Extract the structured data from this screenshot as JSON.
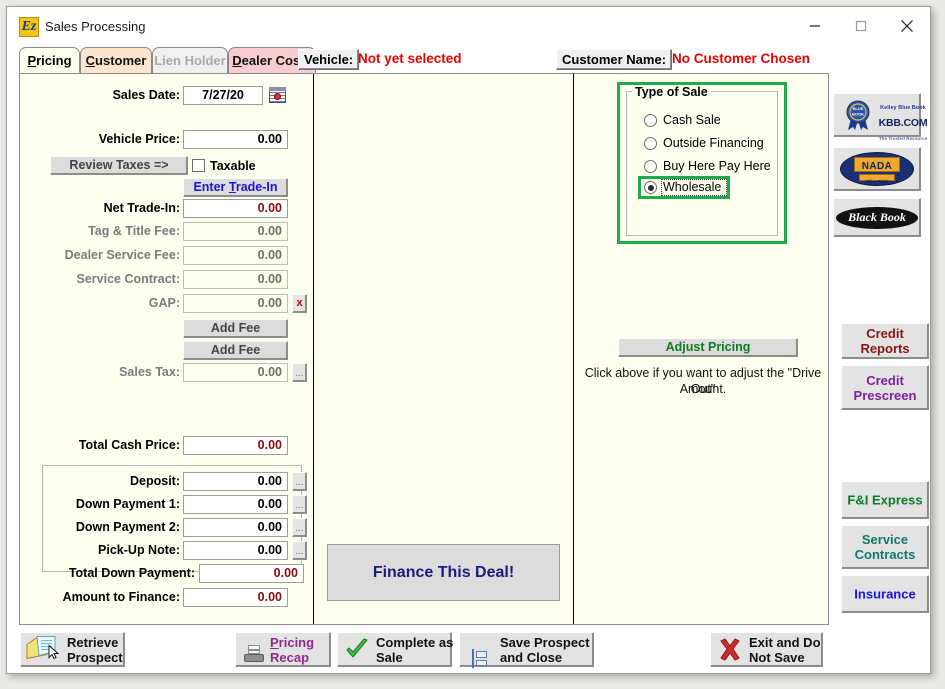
{
  "window": {
    "title": "Sales Processing",
    "app_icon": "ez-logo-icon",
    "minimize_label": "Minimize",
    "maximize_label": "Maximize",
    "close_label": "Close"
  },
  "tabs": [
    {
      "label": "Pricing",
      "accel": "P",
      "state": "active"
    },
    {
      "label": "Customer",
      "accel": "C",
      "state": "normal"
    },
    {
      "label": "Lien Holder",
      "accel": "",
      "state": "disabled"
    },
    {
      "label": "Dealer Costs",
      "accel": "D",
      "state": "normal"
    }
  ],
  "header": {
    "vehicle_button": "Vehicle:",
    "vehicle_value": "Not yet selected",
    "customer_button": "Customer Name:",
    "customer_value": "No Customer Chosen"
  },
  "form": {
    "sales_date_label": "Sales Date:",
    "sales_date_value": "7/27/20",
    "calendar_icon": "calendar-icon",
    "vehicle_price_label": "Vehicle Price:",
    "vehicle_price_value": "0.00",
    "review_taxes_button": "Review Taxes =>",
    "taxable_label": "Taxable",
    "taxable_checked": false,
    "enter_trade_in_button": "Enter Trade-In",
    "enter_trade_in_accel": "T",
    "rows": [
      {
        "label": "Net Trade-In:",
        "value": "0.00",
        "disabled": false,
        "red": true,
        "dots": false
      },
      {
        "label": "Tag & Title Fee:",
        "value": "0.00",
        "disabled": true,
        "red": false,
        "dots": false
      },
      {
        "label": "Dealer Service Fee:",
        "value": "0.00",
        "disabled": true,
        "red": false,
        "dots": false
      },
      {
        "label": "Service Contract:",
        "value": "0.00",
        "disabled": true,
        "red": false,
        "dots": false
      },
      {
        "label": "GAP:",
        "value": "0.00",
        "disabled": true,
        "red": false,
        "dots": false
      }
    ],
    "gap_clear_button": "x",
    "add_fee_1": "Add Fee",
    "add_fee_2": "Add Fee",
    "sales_tax_label": "Sales Tax:",
    "sales_tax_value": "0.00",
    "sales_tax_dots": "...",
    "total_cash_price_label": "Total Cash Price:",
    "total_cash_price_value": "0.00",
    "down_rows": [
      {
        "label": "Deposit:",
        "value": "0.00",
        "dots": "..."
      },
      {
        "label": "Down Payment 1:",
        "value": "0.00",
        "dots": "..."
      },
      {
        "label": "Down Payment 2:",
        "value": "0.00",
        "dots": "..."
      },
      {
        "label": "Pick-Up Note:",
        "value": "0.00",
        "dots": "..."
      }
    ],
    "total_down_label": "Total Down Payment:",
    "total_down_value": "0.00",
    "amount_to_finance_label": "Amount to Finance:",
    "amount_to_finance_value": "0.00",
    "finance_button": "Finance This Deal!"
  },
  "type_of_sale": {
    "title": "Type of Sale",
    "highlight_color": "#1faa4d",
    "options": [
      {
        "label": "Cash Sale",
        "selected": false
      },
      {
        "label": "Outside Financing",
        "selected": false
      },
      {
        "label": "Buy Here Pay Here",
        "selected": false
      },
      {
        "label": "Wholesale",
        "selected": true
      }
    ]
  },
  "adjust": {
    "button_label": "Adjust Pricing",
    "button_color": "#127a25",
    "hint_line1": "Click above if you want to adjust the \"Drive Out\"",
    "hint_line2": "Amount."
  },
  "side_buttons": [
    {
      "name": "kbb",
      "type": "logo",
      "l1": "Kelley Blue Book",
      "l2": "KBB.COM",
      "l3": "The Trusted Resource"
    },
    {
      "name": "nada",
      "type": "logo",
      "l1": "NADA",
      "l2": "Blue Print"
    },
    {
      "name": "blackbook",
      "type": "logo",
      "l1": "Black Book"
    },
    {
      "name": "credit-reports",
      "type": "text",
      "lines": [
        "Credit Reports"
      ],
      "color": "#8a1515"
    },
    {
      "name": "credit-prescreen",
      "type": "text",
      "lines": [
        "Credit",
        "Prescreen"
      ],
      "color": "#7b1f9e"
    },
    {
      "name": "fi-express",
      "type": "text",
      "lines": [
        "F&I Express"
      ],
      "color": "#0f7a2e"
    },
    {
      "name": "service-contracts",
      "type": "text",
      "lines": [
        "Service",
        "Contracts"
      ],
      "color": "#117a6b"
    },
    {
      "name": "insurance",
      "type": "text",
      "lines": [
        "Insurance"
      ],
      "color": "#1616dd"
    }
  ],
  "toolbar": [
    {
      "name": "retrieve-prospect",
      "icon": "folder-icon",
      "lines": [
        "Retrieve",
        "Prospect"
      ],
      "color": "#111111"
    },
    {
      "name": "pricing-recap",
      "icon": "printer-icon",
      "lines": [
        "Pricing",
        "Recap"
      ],
      "color": "#8e2a8e",
      "accel": "P"
    },
    {
      "name": "complete-as-sale",
      "icon": "check-icon",
      "lines": [
        "Complete as",
        "Sale"
      ],
      "color": "#111111"
    },
    {
      "name": "save-prospect-close",
      "icon": "disk-icon",
      "lines": [
        "Save Prospect",
        "and Close"
      ],
      "color": "#111111"
    },
    {
      "name": "exit-do-not-save",
      "icon": "red-x-icon",
      "lines": [
        "Exit and Do",
        "Not Save"
      ],
      "color": "#111111"
    }
  ]
}
